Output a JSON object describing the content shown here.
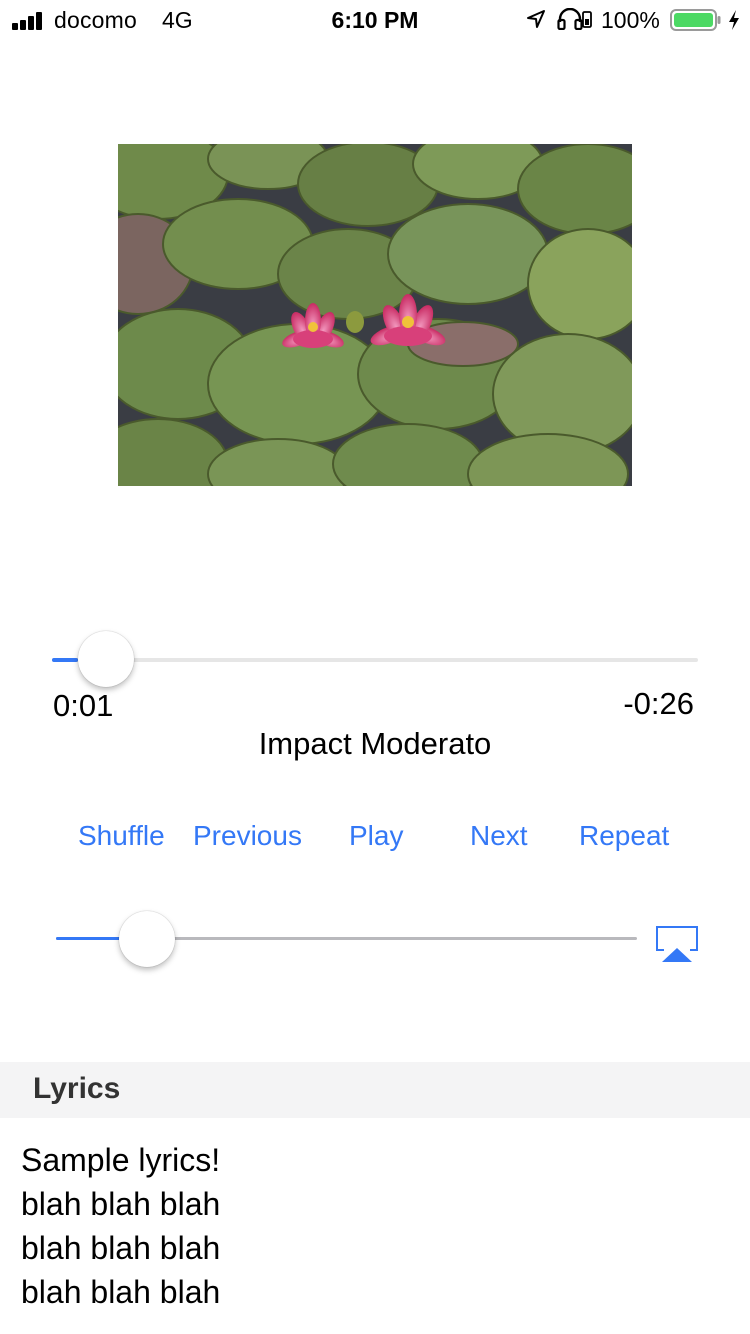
{
  "status_bar": {
    "carrier": "docomo",
    "network": "4G",
    "time": "6:10 PM",
    "battery_percent": "100%",
    "icons": [
      "signal-icon",
      "location-icon",
      "headphones-icon",
      "orientation-lock-icon",
      "battery-icon",
      "charging-icon"
    ]
  },
  "artwork": {
    "description_icon": "water-lily-artwork"
  },
  "player": {
    "elapsed": "0:01",
    "remaining": "-0:26",
    "progress_fraction": 0.04,
    "title": "Impact Moderato"
  },
  "controls": {
    "shuffle": "Shuffle",
    "previous": "Previous",
    "play": "Play",
    "next": "Next",
    "repeat": "Repeat"
  },
  "volume": {
    "level_fraction": 0.12,
    "airplay_icon": "airplay-icon"
  },
  "lyrics": {
    "header": "Lyrics",
    "lines": [
      "Sample lyrics!",
      "blah blah blah",
      "blah blah blah",
      "blah blah blah"
    ]
  },
  "colors": {
    "accent": "#3478f6",
    "section_bg": "#f4f4f5",
    "volume_track": "#b9b9bd"
  }
}
